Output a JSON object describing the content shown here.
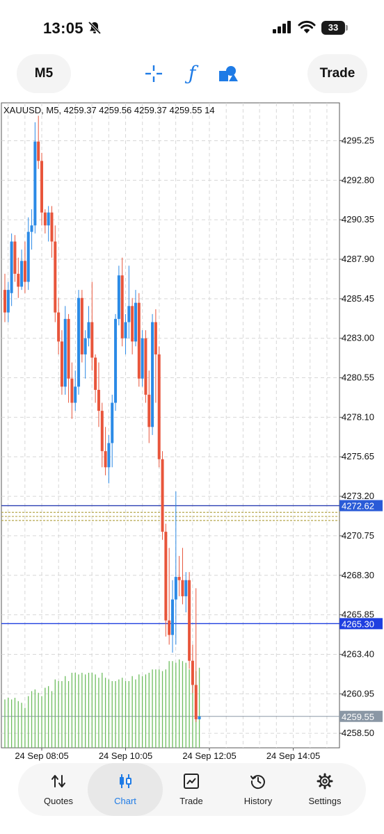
{
  "status_bar": {
    "time": "13:05",
    "battery": "33",
    "icons": [
      "bell-slash-icon",
      "signal-icon",
      "wifi-icon",
      "battery-icon"
    ]
  },
  "toolbar": {
    "timeframe_label": "M5",
    "trade_label": "Trade",
    "tools": [
      "crosshair-icon",
      "function-icon",
      "shapes-icon"
    ]
  },
  "chart": {
    "header": "XAUUSD, M5, 4259.37 4259.56 4259.37 4259.55 14",
    "price_labels": [
      "4295.25",
      "4292.80",
      "4290.35",
      "4287.90",
      "4285.45",
      "4283.00",
      "4280.55",
      "4278.10",
      "4275.65",
      "4273.20",
      "4270.75",
      "4268.30",
      "4265.85",
      "4263.40",
      "4260.95",
      "4258.50"
    ],
    "time_labels": [
      "24 Sep 08:05",
      "24 Sep 10:05",
      "24 Sep 12:05",
      "24 Sep 14:05"
    ],
    "price_tags": [
      {
        "value": "4272.62",
        "price": 4272.62,
        "bg": "#2a5bd7",
        "line": "#2b3fb3"
      },
      {
        "value": "4265.30",
        "price": 4265.3,
        "bg": "#1f3fe0",
        "line": "#1f3fe0"
      },
      {
        "value": "4259.55",
        "price": 4259.55,
        "bg": "#8a97a5",
        "line": "#8a97a5"
      }
    ],
    "colors": {
      "bull": "#2b8ae6",
      "bear": "#e8553b",
      "volume": "#6dbd5e",
      "grid": "#d7d7d7",
      "order_line": "#b6a64b"
    }
  },
  "chart_data": {
    "type": "candlestick",
    "symbol": "XAUUSD",
    "timeframe": "M5",
    "ylim": [
      4257.6,
      4297.6
    ],
    "candles": [
      {
        "o": 4286.0,
        "h": 4287.0,
        "l": 4284.0,
        "c": 4284.6
      },
      {
        "o": 4284.6,
        "h": 4286.5,
        "l": 4284.0,
        "c": 4286.0
      },
      {
        "o": 4285.8,
        "h": 4289.5,
        "l": 4285.0,
        "c": 4289.0
      },
      {
        "o": 4289.0,
        "h": 4289.4,
        "l": 4286.5,
        "c": 4287.0
      },
      {
        "o": 4287.0,
        "h": 4288.0,
        "l": 4285.5,
        "c": 4286.2
      },
      {
        "o": 4286.2,
        "h": 4288.5,
        "l": 4286.0,
        "c": 4287.8
      },
      {
        "o": 4287.8,
        "h": 4289.0,
        "l": 4285.8,
        "c": 4286.5
      },
      {
        "o": 4286.5,
        "h": 4290.5,
        "l": 4286.0,
        "c": 4289.6
      },
      {
        "o": 4289.6,
        "h": 4291.0,
        "l": 4288.5,
        "c": 4290.0
      },
      {
        "o": 4290.0,
        "h": 4296.4,
        "l": 4289.5,
        "c": 4295.2
      },
      {
        "o": 4295.2,
        "h": 4296.8,
        "l": 4293.5,
        "c": 4294.0
      },
      {
        "o": 4294.0,
        "h": 4294.5,
        "l": 4290.0,
        "c": 4290.8
      },
      {
        "o": 4290.8,
        "h": 4291.0,
        "l": 4289.5,
        "c": 4290.0
      },
      {
        "o": 4290.0,
        "h": 4291.2,
        "l": 4289.0,
        "c": 4290.8
      },
      {
        "o": 4290.8,
        "h": 4291.2,
        "l": 4288.0,
        "c": 4289.0
      },
      {
        "o": 4289.0,
        "h": 4290.0,
        "l": 4284.0,
        "c": 4284.6
      },
      {
        "o": 4284.6,
        "h": 4285.5,
        "l": 4282.0,
        "c": 4282.8
      },
      {
        "o": 4282.8,
        "h": 4283.5,
        "l": 4279.5,
        "c": 4280.0
      },
      {
        "o": 4280.0,
        "h": 4285.0,
        "l": 4279.5,
        "c": 4284.2
      },
      {
        "o": 4284.2,
        "h": 4284.5,
        "l": 4279.0,
        "c": 4280.5
      },
      {
        "o": 4280.5,
        "h": 4281.5,
        "l": 4278.0,
        "c": 4279.0
      },
      {
        "o": 4279.0,
        "h": 4281.0,
        "l": 4278.5,
        "c": 4280.0
      },
      {
        "o": 4280.0,
        "h": 4286.0,
        "l": 4279.5,
        "c": 4285.5
      },
      {
        "o": 4285.5,
        "h": 4286.0,
        "l": 4281.5,
        "c": 4282.0
      },
      {
        "o": 4282.0,
        "h": 4283.5,
        "l": 4280.5,
        "c": 4283.0
      },
      {
        "o": 4283.0,
        "h": 4285.0,
        "l": 4282.5,
        "c": 4284.0
      },
      {
        "o": 4284.0,
        "h": 4286.5,
        "l": 4281.0,
        "c": 4281.8
      },
      {
        "o": 4281.8,
        "h": 4282.0,
        "l": 4279.0,
        "c": 4279.8
      },
      {
        "o": 4279.8,
        "h": 4281.5,
        "l": 4277.5,
        "c": 4278.5
      },
      {
        "o": 4278.5,
        "h": 4279.0,
        "l": 4275.0,
        "c": 4276.0
      },
      {
        "o": 4276.0,
        "h": 4277.5,
        "l": 4274.5,
        "c": 4275.0
      },
      {
        "o": 4275.0,
        "h": 4277.0,
        "l": 4274.0,
        "c": 4276.5
      },
      {
        "o": 4276.5,
        "h": 4279.5,
        "l": 4275.0,
        "c": 4279.0
      },
      {
        "o": 4279.0,
        "h": 4284.5,
        "l": 4278.5,
        "c": 4284.2
      },
      {
        "o": 4284.2,
        "h": 4287.5,
        "l": 4283.8,
        "c": 4286.9
      },
      {
        "o": 4286.9,
        "h": 4288.0,
        "l": 4282.5,
        "c": 4283.0
      },
      {
        "o": 4283.0,
        "h": 4284.5,
        "l": 4282.0,
        "c": 4284.0
      },
      {
        "o": 4284.0,
        "h": 4287.5,
        "l": 4283.0,
        "c": 4285.0
      },
      {
        "o": 4285.0,
        "h": 4285.5,
        "l": 4282.0,
        "c": 4282.8
      },
      {
        "o": 4282.8,
        "h": 4286.0,
        "l": 4282.5,
        "c": 4285.2
      },
      {
        "o": 4285.2,
        "h": 4285.8,
        "l": 4280.0,
        "c": 4280.5
      },
      {
        "o": 4280.5,
        "h": 4283.5,
        "l": 4280.0,
        "c": 4283.0
      },
      {
        "o": 4283.0,
        "h": 4283.5,
        "l": 4279.0,
        "c": 4279.5
      },
      {
        "o": 4279.5,
        "h": 4281.0,
        "l": 4276.5,
        "c": 4277.5
      },
      {
        "o": 4277.5,
        "h": 4284.5,
        "l": 4277.0,
        "c": 4284.0
      },
      {
        "o": 4284.0,
        "h": 4284.8,
        "l": 4279.0,
        "c": 4282.0
      },
      {
        "o": 4282.0,
        "h": 4282.5,
        "l": 4275.0,
        "c": 4275.5
      },
      {
        "o": 4275.5,
        "h": 4276.0,
        "l": 4270.5,
        "c": 4271.0
      },
      {
        "o": 4271.0,
        "h": 4271.5,
        "l": 4264.5,
        "c": 4265.5
      },
      {
        "o": 4265.5,
        "h": 4270.0,
        "l": 4264.0,
        "c": 4264.6
      },
      {
        "o": 4264.6,
        "h": 4268.0,
        "l": 4263.5,
        "c": 4266.8
      },
      {
        "o": 4266.8,
        "h": 4273.5,
        "l": 4264.0,
        "c": 4268.2
      },
      {
        "o": 4268.2,
        "h": 4269.5,
        "l": 4267.0,
        "c": 4268.0
      },
      {
        "o": 4268.0,
        "h": 4270.0,
        "l": 4266.5,
        "c": 4267.0
      },
      {
        "o": 4267.0,
        "h": 4268.5,
        "l": 4266.0,
        "c": 4268.0
      },
      {
        "o": 4268.0,
        "h": 4268.5,
        "l": 4262.5,
        "c": 4263.0
      },
      {
        "o": 4263.0,
        "h": 4264.0,
        "l": 4261.0,
        "c": 4261.5
      },
      {
        "o": 4261.5,
        "h": 4267.5,
        "l": 4259.2,
        "c": 4259.37
      },
      {
        "o": 4259.37,
        "h": 4259.56,
        "l": 4259.37,
        "c": 4259.55
      }
    ],
    "volumes": [
      29,
      30,
      29,
      30,
      28,
      27,
      24,
      31,
      34,
      35,
      33,
      31,
      36,
      37,
      34,
      41,
      40,
      40,
      43,
      40,
      45,
      45,
      44,
      45,
      44,
      45,
      45,
      44,
      42,
      45,
      42,
      41,
      40,
      40,
      41,
      42,
      40,
      40,
      43,
      41,
      44,
      43,
      44,
      45,
      47,
      47,
      47,
      46,
      47,
      52,
      52,
      51,
      53,
      52,
      51,
      47,
      45,
      46,
      48
    ]
  },
  "tabs": [
    {
      "label": "Quotes",
      "icon": "quotes-arrows-icon"
    },
    {
      "label": "Chart",
      "icon": "candlestick-icon",
      "active": true
    },
    {
      "label": "Trade",
      "icon": "trade-chart-icon"
    },
    {
      "label": "History",
      "icon": "history-clock-icon"
    },
    {
      "label": "Settings",
      "icon": "gear-icon"
    }
  ]
}
